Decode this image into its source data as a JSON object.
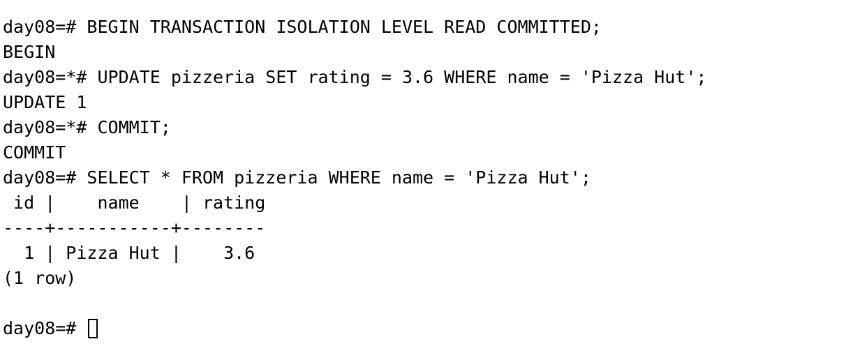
{
  "terminal": {
    "lines": [
      "day08=# BEGIN TRANSACTION ISOLATION LEVEL READ COMMITTED;",
      "BEGIN",
      "day08=*# UPDATE pizzeria SET rating = 3.6 WHERE name = 'Pizza Hut';",
      "UPDATE 1",
      "day08=*# COMMIT;",
      "COMMIT",
      "day08=# SELECT * FROM pizzeria WHERE name = 'Pizza Hut';",
      " id |    name    | rating",
      "----+-----------+--------",
      "  1 | Pizza Hut |    3.6",
      "(1 row)",
      ""
    ],
    "prompt": "day08=# "
  }
}
